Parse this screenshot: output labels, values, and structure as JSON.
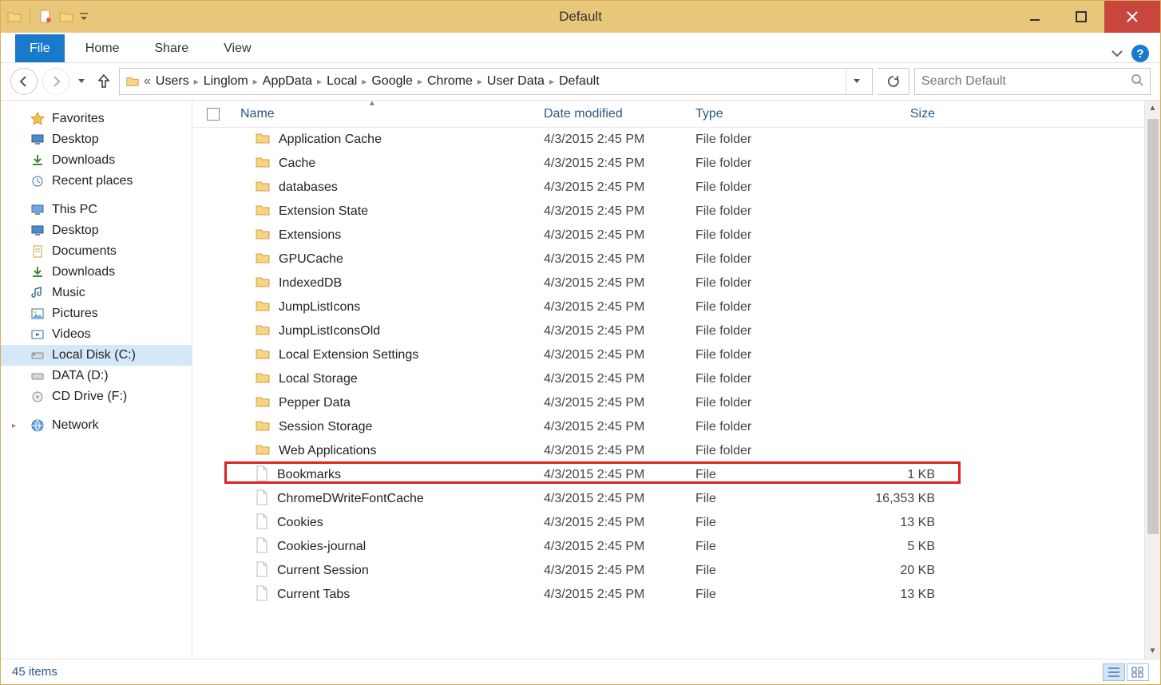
{
  "window": {
    "title": "Default"
  },
  "ribbon": {
    "file": "File",
    "tabs": [
      "Home",
      "Share",
      "View"
    ]
  },
  "breadcrumb": {
    "overflow": "«",
    "items": [
      "Users",
      "Linglom",
      "AppData",
      "Local",
      "Google",
      "Chrome",
      "User Data",
      "Default"
    ]
  },
  "search": {
    "placeholder": "Search Default"
  },
  "navpane": {
    "favorites": {
      "label": "Favorites",
      "items": [
        "Desktop",
        "Downloads",
        "Recent places"
      ]
    },
    "thispc": {
      "label": "This PC",
      "items": [
        "Desktop",
        "Documents",
        "Downloads",
        "Music",
        "Pictures",
        "Videos",
        "Local Disk (C:)",
        "DATA (D:)",
        "CD Drive (F:)"
      ]
    },
    "network": {
      "label": "Network"
    }
  },
  "columns": {
    "name": "Name",
    "date": "Date modified",
    "type": "Type",
    "size": "Size"
  },
  "files": [
    {
      "name": "Application Cache",
      "date": "4/3/2015 2:45 PM",
      "type": "File folder",
      "size": "",
      "icon": "folder"
    },
    {
      "name": "Cache",
      "date": "4/3/2015 2:45 PM",
      "type": "File folder",
      "size": "",
      "icon": "folder"
    },
    {
      "name": "databases",
      "date": "4/3/2015 2:45 PM",
      "type": "File folder",
      "size": "",
      "icon": "folder"
    },
    {
      "name": "Extension State",
      "date": "4/3/2015 2:45 PM",
      "type": "File folder",
      "size": "",
      "icon": "folder"
    },
    {
      "name": "Extensions",
      "date": "4/3/2015 2:45 PM",
      "type": "File folder",
      "size": "",
      "icon": "folder"
    },
    {
      "name": "GPUCache",
      "date": "4/3/2015 2:45 PM",
      "type": "File folder",
      "size": "",
      "icon": "folder"
    },
    {
      "name": "IndexedDB",
      "date": "4/3/2015 2:45 PM",
      "type": "File folder",
      "size": "",
      "icon": "folder"
    },
    {
      "name": "JumpListIcons",
      "date": "4/3/2015 2:45 PM",
      "type": "File folder",
      "size": "",
      "icon": "folder"
    },
    {
      "name": "JumpListIconsOld",
      "date": "4/3/2015 2:45 PM",
      "type": "File folder",
      "size": "",
      "icon": "folder"
    },
    {
      "name": "Local Extension Settings",
      "date": "4/3/2015 2:45 PM",
      "type": "File folder",
      "size": "",
      "icon": "folder"
    },
    {
      "name": "Local Storage",
      "date": "4/3/2015 2:45 PM",
      "type": "File folder",
      "size": "",
      "icon": "folder"
    },
    {
      "name": "Pepper Data",
      "date": "4/3/2015 2:45 PM",
      "type": "File folder",
      "size": "",
      "icon": "folder"
    },
    {
      "name": "Session Storage",
      "date": "4/3/2015 2:45 PM",
      "type": "File folder",
      "size": "",
      "icon": "folder"
    },
    {
      "name": "Web Applications",
      "date": "4/3/2015 2:45 PM",
      "type": "File folder",
      "size": "",
      "icon": "folder"
    },
    {
      "name": "Bookmarks",
      "date": "4/3/2015 2:45 PM",
      "type": "File",
      "size": "1 KB",
      "icon": "file",
      "highlight": true
    },
    {
      "name": "ChromeDWriteFontCache",
      "date": "4/3/2015 2:45 PM",
      "type": "File",
      "size": "16,353 KB",
      "icon": "file"
    },
    {
      "name": "Cookies",
      "date": "4/3/2015 2:45 PM",
      "type": "File",
      "size": "13 KB",
      "icon": "file"
    },
    {
      "name": "Cookies-journal",
      "date": "4/3/2015 2:45 PM",
      "type": "File",
      "size": "5 KB",
      "icon": "file"
    },
    {
      "name": "Current Session",
      "date": "4/3/2015 2:45 PM",
      "type": "File",
      "size": "20 KB",
      "icon": "file"
    },
    {
      "name": "Current Tabs",
      "date": "4/3/2015 2:45 PM",
      "type": "File",
      "size": "13 KB",
      "icon": "file"
    }
  ],
  "status": {
    "count": "45 items"
  }
}
